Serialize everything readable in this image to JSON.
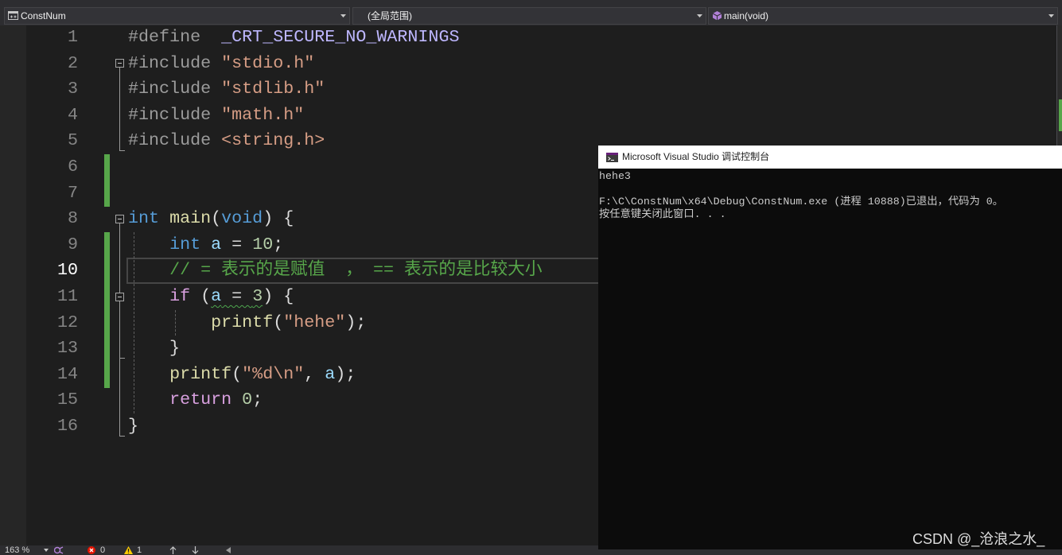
{
  "nav": {
    "project": {
      "label": "ConstNum",
      "icon": "cpp-project-icon"
    },
    "scope": {
      "label": "(全局范围)"
    },
    "member": {
      "label": "main(void)",
      "icon": "method-cube-icon"
    }
  },
  "theme": {
    "background": "#1e1e1e",
    "preproc": "#9b9b9b",
    "macro": "#beb7ff",
    "string": "#d69d85",
    "keyword": "#569cd6",
    "control": "#d8a0df",
    "function": "#dcdcaa",
    "variable": "#9cdcfe",
    "number": "#b5cea8",
    "comment": "#57a64a",
    "punct": "#dcdcdc",
    "change_bar": "#57a64a",
    "squiggle": "#4ea64e"
  },
  "editor": {
    "current_line": "10",
    "folds": [
      {
        "start": 2,
        "end": 5
      },
      {
        "start": 8,
        "end": 16
      },
      {
        "start": 11,
        "end": 13
      }
    ],
    "lines": [
      {
        "n": "1",
        "tokens": [
          {
            "t": "#define",
            "k": "preproc"
          },
          {
            "t": "  ",
            "k": "punct"
          },
          {
            "t": "_CRT_SECURE_NO_WARNINGS",
            "k": "macro"
          }
        ]
      },
      {
        "n": "2",
        "tokens": [
          {
            "t": "#include",
            "k": "preproc"
          },
          {
            "t": " ",
            "k": "punct"
          },
          {
            "t": "\"stdio.h\"",
            "k": "string"
          }
        ]
      },
      {
        "n": "3",
        "tokens": [
          {
            "t": "#include",
            "k": "preproc"
          },
          {
            "t": " ",
            "k": "punct"
          },
          {
            "t": "\"stdlib.h\"",
            "k": "string"
          }
        ]
      },
      {
        "n": "4",
        "tokens": [
          {
            "t": "#include",
            "k": "preproc"
          },
          {
            "t": " ",
            "k": "punct"
          },
          {
            "t": "\"math.h\"",
            "k": "string"
          }
        ]
      },
      {
        "n": "5",
        "tokens": [
          {
            "t": "#include",
            "k": "preproc"
          },
          {
            "t": " ",
            "k": "punct"
          },
          {
            "t": "<string.h>",
            "k": "string"
          }
        ]
      },
      {
        "n": "6",
        "changed": true,
        "tokens": []
      },
      {
        "n": "7",
        "changed": true,
        "tokens": []
      },
      {
        "n": "8",
        "tokens": [
          {
            "t": "int",
            "k": "keyword"
          },
          {
            "t": " ",
            "k": "punct"
          },
          {
            "t": "main",
            "k": "function"
          },
          {
            "t": "(",
            "k": "punct"
          },
          {
            "t": "void",
            "k": "keyword"
          },
          {
            "t": ") {",
            "k": "punct"
          }
        ]
      },
      {
        "n": "9",
        "changed": true,
        "tokens": [
          {
            "t": "    ",
            "k": "punct"
          },
          {
            "t": "int",
            "k": "keyword"
          },
          {
            "t": " ",
            "k": "punct"
          },
          {
            "t": "a",
            "k": "variable"
          },
          {
            "t": " = ",
            "k": "punct"
          },
          {
            "t": "10",
            "k": "number"
          },
          {
            "t": ";",
            "k": "punct"
          }
        ]
      },
      {
        "n": "10",
        "changed": true,
        "tokens": [
          {
            "t": "    ",
            "k": "punct"
          },
          {
            "t": "// = 表示的是赋值  ， == 表示的是比较大小",
            "k": "comment"
          }
        ]
      },
      {
        "n": "11",
        "changed": true,
        "tokens": [
          {
            "t": "    ",
            "k": "punct"
          },
          {
            "t": "if",
            "k": "control"
          },
          {
            "t": " (",
            "k": "punct"
          },
          {
            "t": "a",
            "k": "variable",
            "squiggle": true
          },
          {
            "t": " = ",
            "k": "punct",
            "squiggle": true
          },
          {
            "t": "3",
            "k": "number",
            "squiggle": true
          },
          {
            "t": ") {",
            "k": "punct"
          }
        ]
      },
      {
        "n": "12",
        "changed": true,
        "tokens": [
          {
            "t": "        ",
            "k": "punct"
          },
          {
            "t": "printf",
            "k": "function"
          },
          {
            "t": "(",
            "k": "punct"
          },
          {
            "t": "\"hehe\"",
            "k": "string"
          },
          {
            "t": ");",
            "k": "punct"
          }
        ]
      },
      {
        "n": "13",
        "changed": true,
        "tokens": [
          {
            "t": "    }",
            "k": "punct"
          }
        ]
      },
      {
        "n": "14",
        "changed": true,
        "tokens": [
          {
            "t": "    ",
            "k": "punct"
          },
          {
            "t": "printf",
            "k": "function"
          },
          {
            "t": "(",
            "k": "punct"
          },
          {
            "t": "\"%d\\n\"",
            "k": "string"
          },
          {
            "t": ", ",
            "k": "punct"
          },
          {
            "t": "a",
            "k": "variable"
          },
          {
            "t": ");",
            "k": "punct"
          }
        ]
      },
      {
        "n": "15",
        "tokens": [
          {
            "t": "    ",
            "k": "punct"
          },
          {
            "t": "return",
            "k": "control"
          },
          {
            "t": " ",
            "k": "punct"
          },
          {
            "t": "0",
            "k": "number"
          },
          {
            "t": ";",
            "k": "punct"
          }
        ]
      },
      {
        "n": "16",
        "tokens": [
          {
            "t": "}",
            "k": "punct"
          }
        ]
      }
    ]
  },
  "console": {
    "title": "Microsoft Visual Studio 调试控制台",
    "icon": "console-app-icon",
    "lines": [
      "hehe3",
      "",
      "F:\\C\\ConstNum\\x64\\Debug\\ConstNum.exe (进程 10888)已退出，代码为 0。",
      "按任意键关闭此窗口. . ."
    ]
  },
  "status": {
    "zoom": "163 %",
    "errors": "0",
    "warnings": "1",
    "icons": {
      "zoom": "chevron-down-icon",
      "cleanup": "code-cleanup-icon",
      "errors": "error-icon",
      "warnings": "warning-icon",
      "previous": "arrow-up-icon",
      "next": "arrow-down-icon",
      "scroll_left": "triangle-left-icon"
    }
  },
  "watermark": "CSDN @_沧浪之水_"
}
